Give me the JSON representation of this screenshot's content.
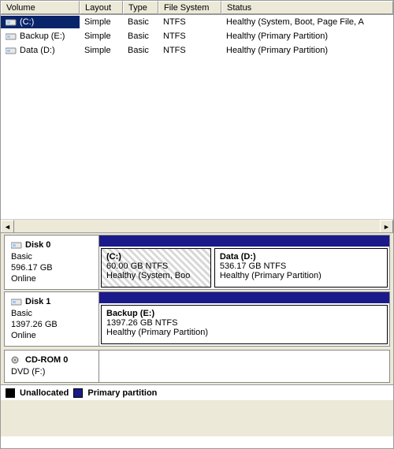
{
  "columns": {
    "volume": "Volume",
    "layout": "Layout",
    "type": "Type",
    "fs": "File System",
    "status": "Status"
  },
  "volumes": [
    {
      "name": "(C:)",
      "layout": "Simple",
      "type": "Basic",
      "fs": "NTFS",
      "status": "Healthy (System, Boot, Page File, A",
      "selected": true
    },
    {
      "name": "Backup (E:)",
      "layout": "Simple",
      "type": "Basic",
      "fs": "NTFS",
      "status": "Healthy (Primary Partition)",
      "selected": false
    },
    {
      "name": "Data (D:)",
      "layout": "Simple",
      "type": "Basic",
      "fs": "NTFS",
      "status": "Healthy (Primary Partition)",
      "selected": false
    }
  ],
  "disks": [
    {
      "title": "Disk 0",
      "dtype": "Basic",
      "size": "596.17 GB",
      "dstatus": "Online",
      "partitions": [
        {
          "name": "(C:)",
          "info": "60.00 GB NTFS",
          "health": "Healthy (System, Boo",
          "hatched": true,
          "flexw": "0 0 38%"
        },
        {
          "name": "Data  (D:)",
          "info": "536.17 GB NTFS",
          "health": "Healthy (Primary Partition)",
          "hatched": false,
          "flexw": "1"
        }
      ]
    },
    {
      "title": "Disk 1",
      "dtype": "Basic",
      "size": "1397.26 GB",
      "dstatus": "Online",
      "partitions": [
        {
          "name": "Backup  (E:)",
          "info": "1397.26 GB NTFS",
          "health": "Healthy (Primary Partition)",
          "hatched": false,
          "flexw": "1"
        }
      ]
    }
  ],
  "cdrom": {
    "title": "CD-ROM 0",
    "sub": "DVD (F:)"
  },
  "legend": {
    "unalloc": "Unallocated",
    "primary": "Primary partition"
  }
}
